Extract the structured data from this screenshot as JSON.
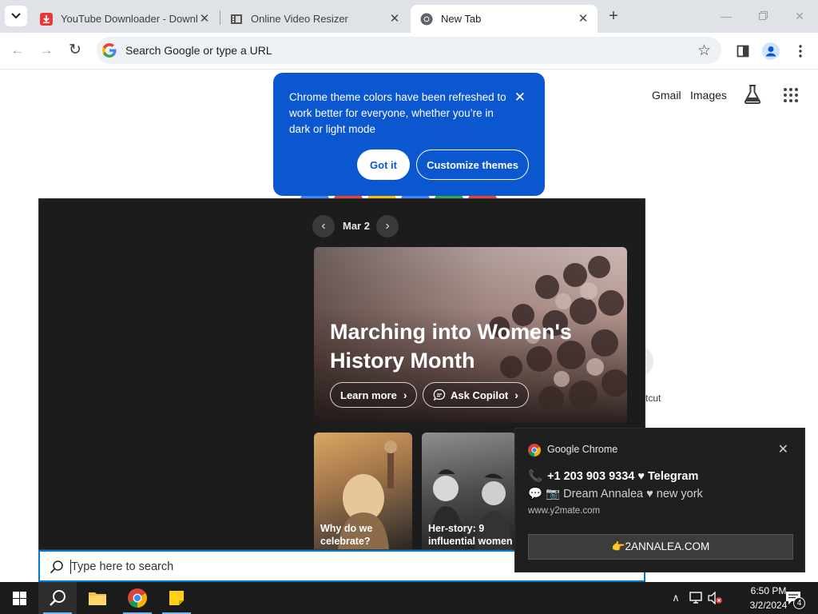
{
  "browser": {
    "tabs": [
      {
        "title": "YouTube Downloader - Downlo",
        "favicon": "youtube-downloader-icon",
        "active": false
      },
      {
        "title": "Online Video Resizer",
        "favicon": "film-icon",
        "active": false
      },
      {
        "title": "New Tab",
        "favicon": "chrome-icon",
        "active": true
      }
    ],
    "omnibox": {
      "placeholder": "Search Google or type a URL"
    }
  },
  "ntp": {
    "links": {
      "gmail": "Gmail",
      "images": "Images"
    },
    "shortcut_fragment": "tcut"
  },
  "theme_bubble": {
    "message": "Chrome theme colors have been refreshed to work better for everyone, whether you’re in dark or light mode",
    "got_it": "Got it",
    "customize": "Customize themes",
    "accent": "#0b57d0"
  },
  "search_panel": {
    "date": "Mar 2",
    "hero": {
      "title": "Marching into Women's History Month",
      "learn_more": "Learn more",
      "ask_copilot": "Ask Copilot"
    },
    "cards": [
      {
        "title": "Why do we celebrate?"
      },
      {
        "title": "Her-story: 9 influential women"
      }
    ],
    "search_placeholder": "Type here to search"
  },
  "toast": {
    "app": "Google Chrome",
    "line1": "+1 203 903 9334 ♥ Telegram",
    "line2": "💬 📷 Dream Annalea ♥ new york",
    "site": "www.y2mate.com",
    "action": "👉2ANNALEA.COM"
  },
  "taskbar": {
    "time": "6:50 PM",
    "date": "3/2/2024",
    "notification_count": "4"
  }
}
